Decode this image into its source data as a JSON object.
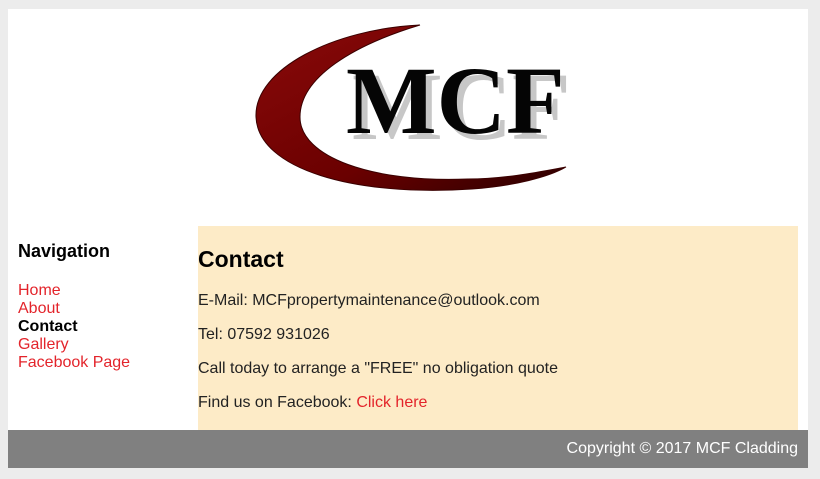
{
  "logo": {
    "text": "MCF",
    "icon": "mcf-swoosh-logo"
  },
  "nav": {
    "heading": "Navigation",
    "items": [
      {
        "label": "Home",
        "current": false
      },
      {
        "label": "About",
        "current": false
      },
      {
        "label": "Contact",
        "current": true
      },
      {
        "label": "Gallery",
        "current": false
      },
      {
        "label": "Facebook Page",
        "current": false
      }
    ]
  },
  "content": {
    "title": "Contact",
    "email_line": "E-Mail: MCFpropertymaintenance@outlook.com",
    "tel_line": "Tel: 07592 931026",
    "call_line": "Call today to arrange a \"FREE\" no obligation quote",
    "facebook_prefix": "Find us on Facebook: ",
    "facebook_link": "Click here"
  },
  "footer": {
    "copyright": "Copyright © 2017 MCF Cladding"
  },
  "colors": {
    "page_bg": "#ececec",
    "link": "#e3242b",
    "content_bg": "#fdebc7",
    "footer_bg": "#808080",
    "logo_swoosh": "#7a0000"
  }
}
